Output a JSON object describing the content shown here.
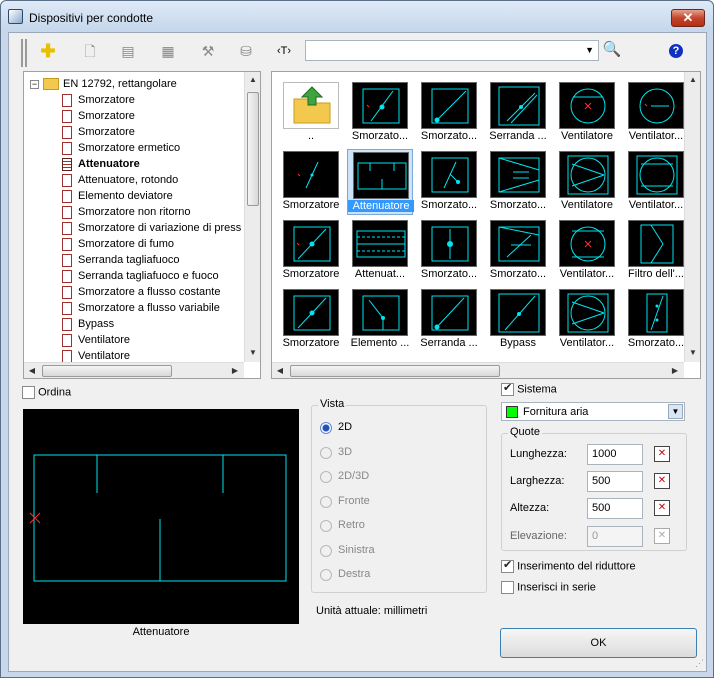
{
  "window": {
    "title": "Dispositivi per condotte",
    "close_label": "✕"
  },
  "toolbar": {
    "text_tool": "‹T›",
    "search_value": "",
    "help_label": "?"
  },
  "tree": {
    "root": "EN 12792, rettangolare",
    "items": [
      "Smorzatore",
      "Smorzatore",
      "Smorzatore",
      "Smorzatore ermetico",
      "Attenuatore",
      "Attenuatore, rotondo",
      "Elemento deviatore",
      "Smorzatore non ritorno",
      "Smorzatore di variazione di press",
      "Smorzatore di fumo",
      "Serranda tagliafuoco",
      "Serranda tagliafuoco e fuoco",
      "Smorzatore a flusso costante",
      "Smorzatore a flusso variabile",
      "Bypass",
      "Ventilatore",
      "Ventilatore"
    ],
    "selected_index": 4
  },
  "grid": {
    "cells": [
      "..",
      "Smorzato...",
      "Smorzato...",
      "Serranda ...",
      "Ventilatore",
      "Ventilator...",
      "Smorzatore",
      "Attenuatore",
      "Smorzato...",
      "Smorzato...",
      "Ventilatore",
      "Ventilator...",
      "Smorzatore",
      "Attenuat...",
      "Smorzato...",
      "Smorzato...",
      "Ventilator...",
      "Filtro dell'...",
      "Smorzatore",
      "Elemento ...",
      "Serranda ...",
      "Bypass",
      "Ventilator...",
      "Smorzato..."
    ],
    "selected_index": 7
  },
  "ordina": {
    "label": "Ordina",
    "checked": false
  },
  "preview": {
    "caption": "Attenuatore"
  },
  "vista": {
    "title": "Vista",
    "options": [
      "2D",
      "3D",
      "2D/3D",
      "Fronte",
      "Retro",
      "Sinistra",
      "Destra"
    ],
    "selected": "2D"
  },
  "units": "Unità attuale: millimetri",
  "sistema": {
    "label": "Sistema",
    "checked": true,
    "value": "Fornitura aria",
    "color": "#00ff00"
  },
  "quote": {
    "title": "Quote",
    "fields": [
      {
        "label": "Lunghezza:",
        "value": "1000"
      },
      {
        "label": "Larghezza:",
        "value": "500"
      },
      {
        "label": "Altezza:",
        "value": "500"
      },
      {
        "label": "Elevazione:",
        "value": "0"
      }
    ]
  },
  "options": {
    "inserimento": {
      "label": "Inserimento del riduttore",
      "checked": true
    },
    "serie": {
      "label": "Inserisci in serie",
      "checked": false
    }
  },
  "ok_label": "OK",
  "colors": {
    "symbol": "#00e5ee",
    "marker": "#ff3030",
    "selection": "#3399ff"
  }
}
